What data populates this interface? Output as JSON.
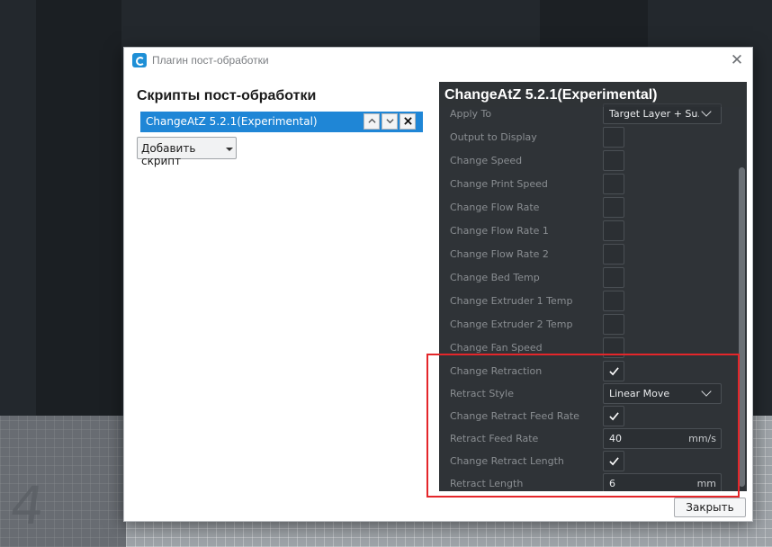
{
  "dialog": {
    "title": "Плагин пост-обработки",
    "close_label": "Закрыть"
  },
  "left_pane": {
    "heading": "Скрипты пост-обработки",
    "scripts": [
      {
        "label": "ChangeAtZ 5.2.1(Experimental)",
        "selected": true
      }
    ],
    "add_script_label": "Добавить скрипт"
  },
  "settings": {
    "title": "ChangeAtZ 5.2.1(Experimental)",
    "rows": [
      {
        "label": "Apply To",
        "kind": "dropdown",
        "value": "Target Layer + Su..."
      },
      {
        "label": "Output to Display",
        "kind": "checkbox",
        "checked": false
      },
      {
        "label": "Change Speed",
        "kind": "checkbox",
        "checked": false
      },
      {
        "label": "Change Print Speed",
        "kind": "checkbox",
        "checked": false
      },
      {
        "label": "Change Flow Rate",
        "kind": "checkbox",
        "checked": false
      },
      {
        "label": "Change Flow Rate 1",
        "kind": "checkbox",
        "checked": false
      },
      {
        "label": "Change Flow Rate 2",
        "kind": "checkbox",
        "checked": false
      },
      {
        "label": "Change Bed Temp",
        "kind": "checkbox",
        "checked": false
      },
      {
        "label": "Change Extruder 1 Temp",
        "kind": "checkbox",
        "checked": false
      },
      {
        "label": "Change Extruder 2 Temp",
        "kind": "checkbox",
        "checked": false
      },
      {
        "label": "Change Fan Speed",
        "kind": "checkbox",
        "checked": false
      },
      {
        "label": "Change Retraction",
        "kind": "checkbox",
        "checked": true
      },
      {
        "label": "Retract Style",
        "kind": "dropdown",
        "value": "Linear Move"
      },
      {
        "label": "Change Retract Feed Rate",
        "kind": "checkbox",
        "checked": true
      },
      {
        "label": "Retract Feed Rate",
        "kind": "number",
        "value": "40",
        "unit": "mm/s"
      },
      {
        "label": "Change Retract Length",
        "kind": "checkbox",
        "checked": true
      },
      {
        "label": "Retract Length",
        "kind": "number",
        "value": "6",
        "unit": "mm"
      }
    ]
  },
  "background": {
    "digit": "4"
  },
  "colors": {
    "accent": "#1f86d6",
    "pane_bg": "#2f3337",
    "highlight": "#e4262a"
  }
}
